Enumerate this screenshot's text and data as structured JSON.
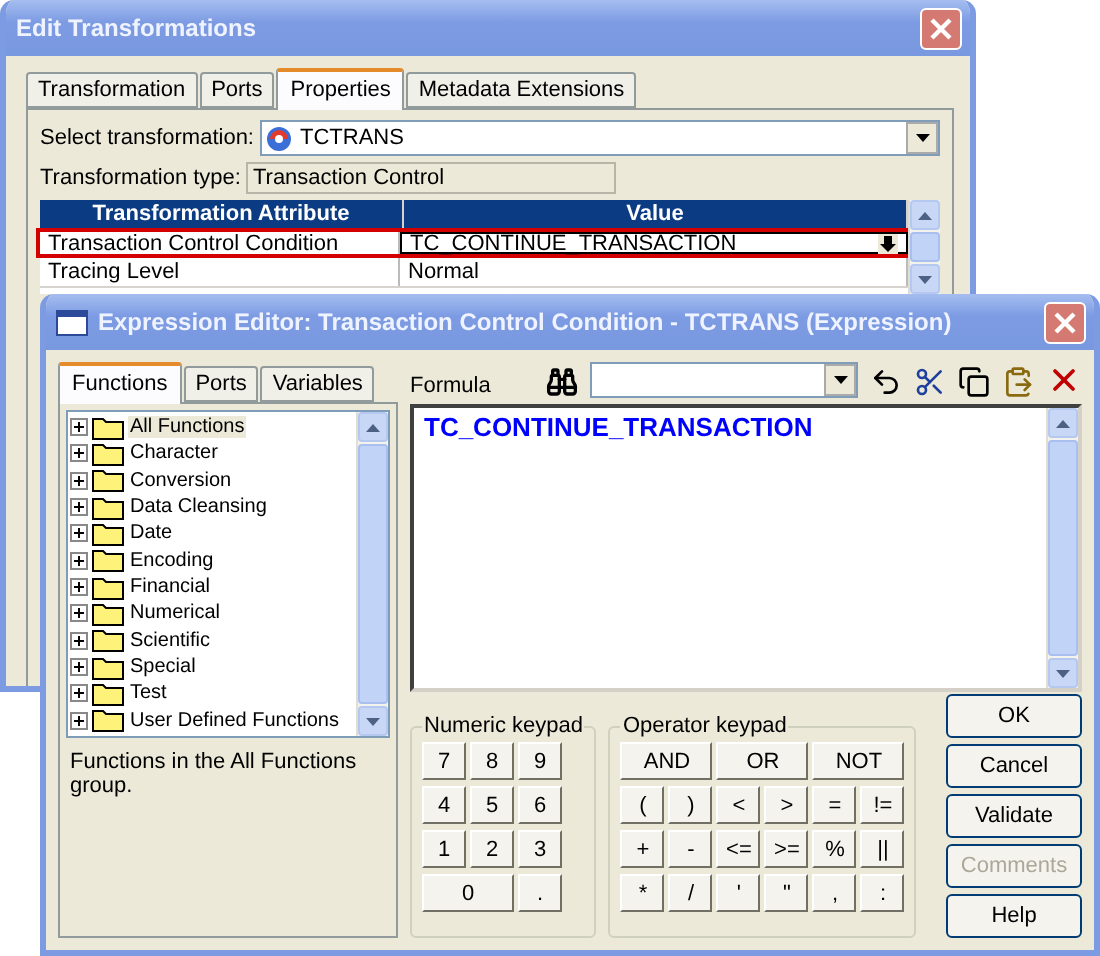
{
  "back_window": {
    "title": "Edit Transformations",
    "tabs": [
      {
        "label": "Transformation",
        "selected": false
      },
      {
        "label": "Ports",
        "selected": false
      },
      {
        "label": "Properties",
        "selected": true
      },
      {
        "label": "Metadata Extensions",
        "selected": false
      }
    ],
    "select_transformation": {
      "label": "Select transformation:",
      "value": "TCTRANS"
    },
    "transformation_type": {
      "label": "Transformation type:",
      "value": "Transaction Control"
    },
    "table": {
      "columns": [
        "Transformation Attribute",
        "Value"
      ],
      "rows": [
        {
          "attribute": "Transaction Control Condition",
          "value": "TC_CONTINUE_TRANSACTION",
          "selected": true
        },
        {
          "attribute": "Tracing Level",
          "value": "Normal",
          "selected": false
        }
      ]
    }
  },
  "editor": {
    "title": "Expression Editor: Transaction Control Condition - TCTRANS (Expression)",
    "tabs": [
      {
        "label": "Functions",
        "selected": true
      },
      {
        "label": "Ports",
        "selected": false
      },
      {
        "label": "Variables",
        "selected": false
      }
    ],
    "tree": [
      {
        "label": "All Functions",
        "selected": true
      },
      {
        "label": "Character",
        "selected": false
      },
      {
        "label": "Conversion",
        "selected": false
      },
      {
        "label": "Data Cleansing",
        "selected": false
      },
      {
        "label": "Date",
        "selected": false
      },
      {
        "label": "Encoding",
        "selected": false
      },
      {
        "label": "Financial",
        "selected": false
      },
      {
        "label": "Numerical",
        "selected": false
      },
      {
        "label": "Scientific",
        "selected": false
      },
      {
        "label": "Special",
        "selected": false
      },
      {
        "label": "Test",
        "selected": false
      },
      {
        "label": "User Defined Functions",
        "selected": false
      }
    ],
    "description": "Functions in the All Functions group.",
    "formula": {
      "label": "Formula",
      "text": "TC_CONTINUE_TRANSACTION"
    },
    "numeric_keypad": {
      "title": "Numeric keypad",
      "keys": [
        {
          "label": "7",
          "kind": "single"
        },
        {
          "label": "8",
          "kind": "single"
        },
        {
          "label": "9",
          "kind": "single"
        },
        {
          "label": "4",
          "kind": "single"
        },
        {
          "label": "5",
          "kind": "single"
        },
        {
          "label": "6",
          "kind": "single"
        },
        {
          "label": "1",
          "kind": "single"
        },
        {
          "label": "2",
          "kind": "single"
        },
        {
          "label": "3",
          "kind": "single"
        },
        {
          "label": "0",
          "kind": "wide"
        },
        {
          "label": ".",
          "kind": "single"
        }
      ]
    },
    "operator_keypad": {
      "title": "Operator keypad",
      "keys": [
        {
          "label": "AND",
          "kind": "wide"
        },
        {
          "label": "OR",
          "kind": "wide"
        },
        {
          "label": "NOT",
          "kind": "wide"
        },
        {
          "label": "(",
          "kind": "single"
        },
        {
          "label": ")",
          "kind": "single"
        },
        {
          "label": "<",
          "kind": "single"
        },
        {
          "label": ">",
          "kind": "single"
        },
        {
          "label": "=",
          "kind": "single"
        },
        {
          "label": "!=",
          "kind": "single"
        },
        {
          "label": "+",
          "kind": "single"
        },
        {
          "label": "-",
          "kind": "single"
        },
        {
          "label": "<=",
          "kind": "single"
        },
        {
          "label": ">=",
          "kind": "single"
        },
        {
          "label": "%",
          "kind": "single"
        },
        {
          "label": "||",
          "kind": "single"
        },
        {
          "label": "*",
          "kind": "single"
        },
        {
          "label": "/",
          "kind": "single"
        },
        {
          "label": "'",
          "kind": "single"
        },
        {
          "label": "\"",
          "kind": "single"
        },
        {
          "label": ",",
          "kind": "single"
        },
        {
          "label": ":",
          "kind": "single"
        }
      ]
    },
    "buttons": [
      {
        "label": "OK",
        "disabled": false
      },
      {
        "label": "Cancel",
        "disabled": false
      },
      {
        "label": "Validate",
        "disabled": false
      },
      {
        "label": "Comments",
        "disabled": true
      },
      {
        "label": "Help",
        "disabled": false
      }
    ]
  }
}
